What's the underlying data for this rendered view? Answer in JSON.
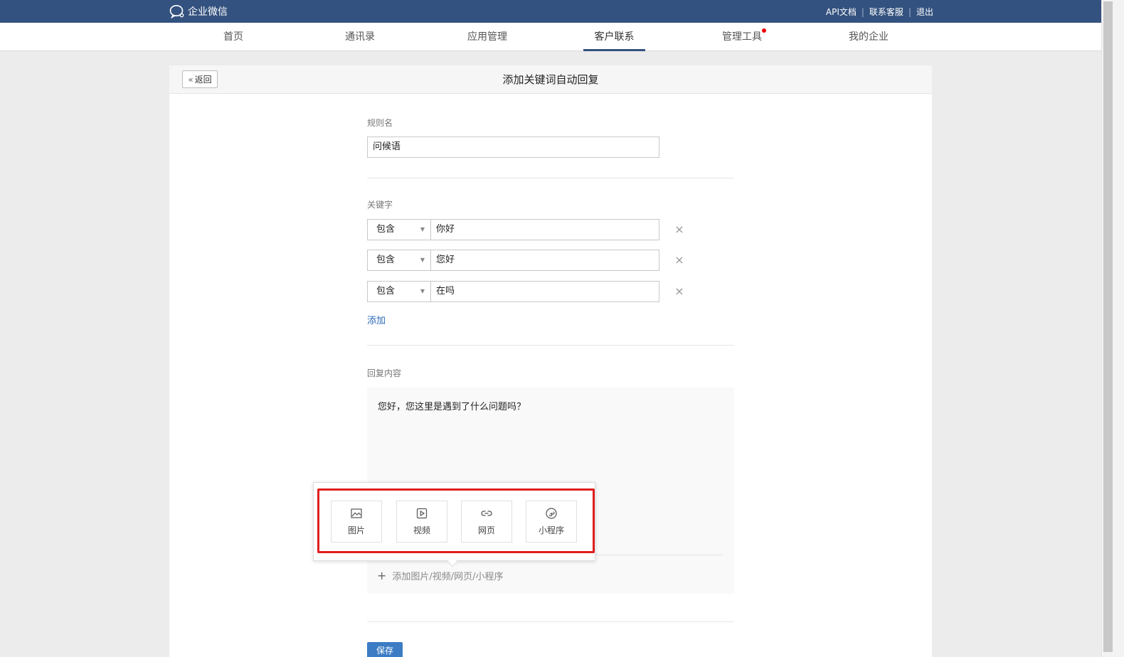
{
  "header": {
    "brand": "企业微信",
    "links": [
      "API文档",
      "联系客服",
      "退出"
    ]
  },
  "nav": {
    "items": [
      {
        "label": "首页"
      },
      {
        "label": "通讯录"
      },
      {
        "label": "应用管理"
      },
      {
        "label": "客户联系",
        "active": true
      },
      {
        "label": "管理工具",
        "has_notification_dot": true
      },
      {
        "label": "我的企业"
      }
    ]
  },
  "page": {
    "back_label": "返回",
    "title": "添加关键词自动回复"
  },
  "form": {
    "rule_name_label": "规则名",
    "rule_name_value": "问候语",
    "keywords_label": "关键字",
    "keywords": [
      {
        "match": "包含",
        "value": "你好"
      },
      {
        "match": "包含",
        "value": "您好"
      },
      {
        "match": "包含",
        "value": "在吗"
      }
    ],
    "add_keyword_label": "添加",
    "reply_label": "回复内容",
    "reply_text": "您好，您这里是遇到了什么问题吗？",
    "attach_label": "添加图片/视频/网页/小程序",
    "save_label": "保存"
  },
  "attach_menu": {
    "items": [
      {
        "label": "图片",
        "icon": "image-icon"
      },
      {
        "label": "视频",
        "icon": "video-icon"
      },
      {
        "label": "网页",
        "icon": "link-icon"
      },
      {
        "label": "小程序",
        "icon": "miniprogram-icon"
      }
    ]
  },
  "colors": {
    "header_bg": "#34527f",
    "link": "#2a6ab8",
    "highlight": "#e01e1e",
    "primary_button": "#3b7cc4"
  }
}
